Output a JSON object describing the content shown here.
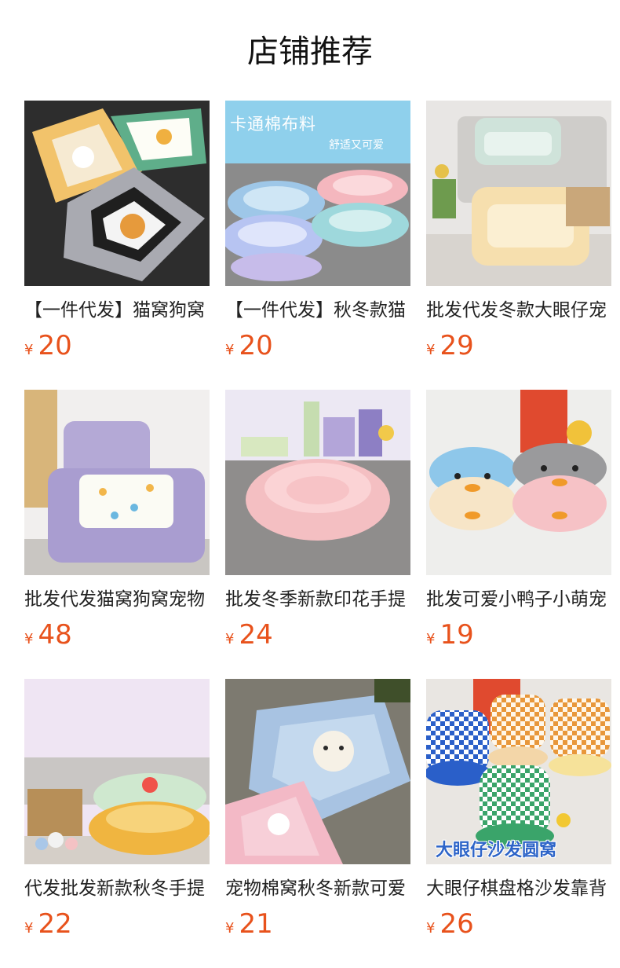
{
  "section": {
    "title": "店铺推荐"
  },
  "currency": "¥",
  "products": [
    {
      "name": "【一件代发】猫窝狗窝",
      "price": "20",
      "image": "square-beds-cartoon"
    },
    {
      "name": "【一件代发】秋冬款猫",
      "price": "20",
      "image": "round-beds-stack",
      "image_text_1": "卡通棉布料",
      "image_text_2": "舒适又可爱"
    },
    {
      "name": "批发代发冬款大眼仔宠",
      "price": "29",
      "image": "striped-sofa-beds"
    },
    {
      "name": "批发代发猫窝狗窝宠物",
      "price": "48",
      "image": "gingham-sofa-bed"
    },
    {
      "name": "批发冬季新款印花手提",
      "price": "24",
      "image": "pink-round-bed"
    },
    {
      "name": "批发可爱小鸭子小萌宠",
      "price": "19",
      "image": "duck-beds"
    },
    {
      "name": "代发批发新款秋冬手提",
      "price": "22",
      "image": "green-yellow-round-beds"
    },
    {
      "name": "宠物棉窝秋冬新款可爱",
      "price": "21",
      "image": "cartoon-blue-pink-beds"
    },
    {
      "name": "大眼仔棋盘格沙发靠背",
      "price": "26",
      "image": "checkered-sofa-beds",
      "image_text_1": "大眼仔沙发圆窝"
    }
  ]
}
